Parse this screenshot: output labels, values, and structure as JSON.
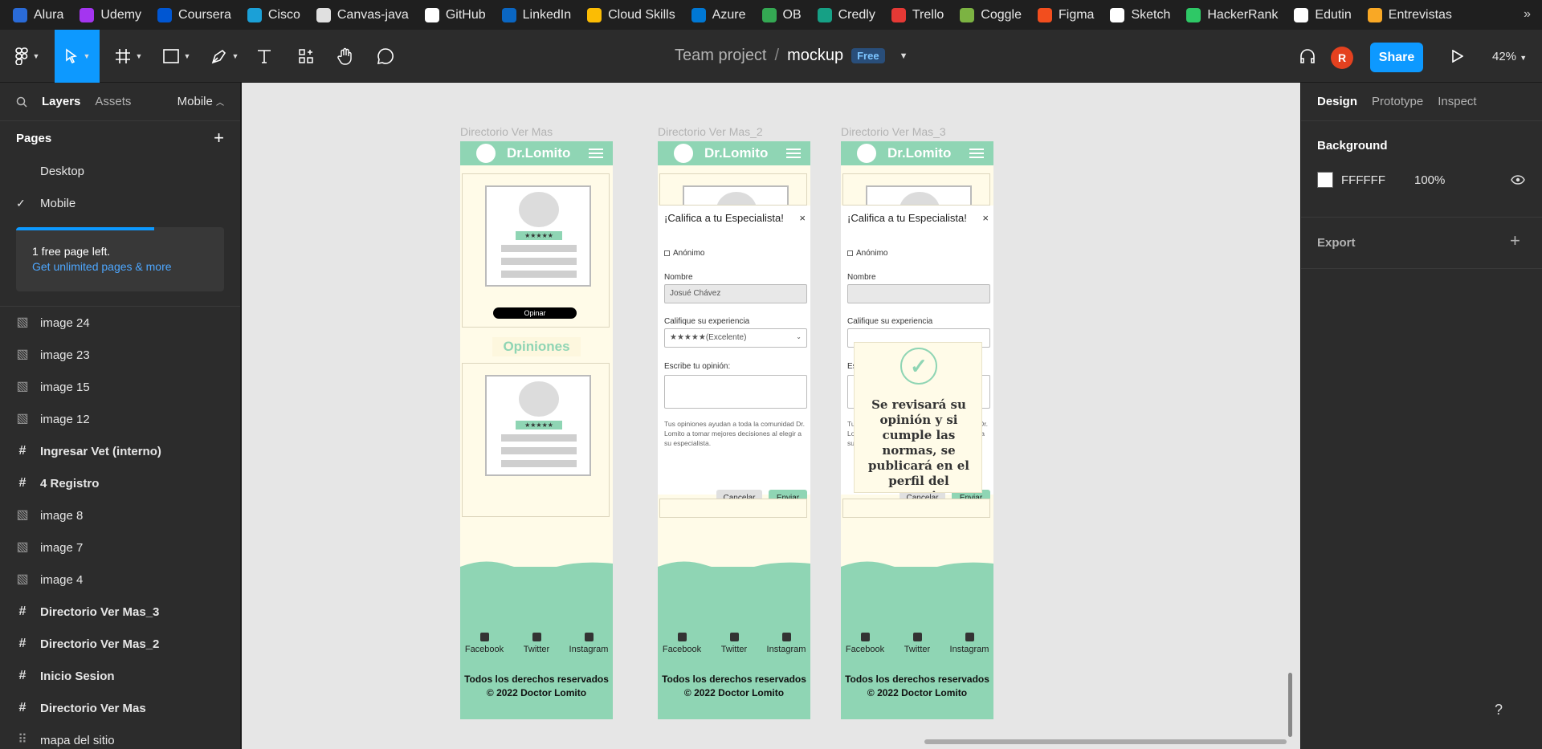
{
  "bookmarks": [
    {
      "label": "Alura",
      "color": "#2a6bd8"
    },
    {
      "label": "Udemy",
      "color": "#a435f0"
    },
    {
      "label": "Coursera",
      "color": "#0056d2"
    },
    {
      "label": "Cisco",
      "color": "#1ba0d7"
    },
    {
      "label": "Canvas-java",
      "color": "#e0e0e0"
    },
    {
      "label": "GitHub",
      "color": "#ffffff"
    },
    {
      "label": "LinkedIn",
      "color": "#0a66c2"
    },
    {
      "label": "Cloud Skills",
      "color": "#fbbc04"
    },
    {
      "label": "Azure",
      "color": "#0078d4"
    },
    {
      "label": "OB",
      "color": "#34a853"
    },
    {
      "label": "Credly",
      "color": "#16a085"
    },
    {
      "label": "Trello",
      "color": "#e53935"
    },
    {
      "label": "Coggle",
      "color": "#7cb342"
    },
    {
      "label": "Figma",
      "color": "#f24e1e"
    },
    {
      "label": "Sketch",
      "color": "#ffffff"
    },
    {
      "label": "HackerRank",
      "color": "#2ec866"
    },
    {
      "label": "Edutin",
      "color": "#ffffff"
    },
    {
      "label": "Entrevistas",
      "color": "#f9a825"
    }
  ],
  "bookmarks_more": "»",
  "header": {
    "team": "Team project",
    "sep": "/",
    "file": "mockup",
    "badge": "Free",
    "share": "Share",
    "avatar": "R",
    "zoom": "42%"
  },
  "left": {
    "tabs": {
      "layers": "Layers",
      "assets": "Assets",
      "page": "Mobile"
    },
    "pages_title": "Pages",
    "pages": [
      {
        "label": "Desktop",
        "checked": false
      },
      {
        "label": "Mobile",
        "checked": true
      }
    ],
    "promo": {
      "line1": "1 free page left.",
      "link": "Get unlimited pages & more"
    },
    "layers": [
      {
        "label": "image 24",
        "type": "image"
      },
      {
        "label": "image 23",
        "type": "image"
      },
      {
        "label": "image 15",
        "type": "image"
      },
      {
        "label": "image 12",
        "type": "image"
      },
      {
        "label": "Ingresar Vet (interno)",
        "type": "frame"
      },
      {
        "label": "4 Registro",
        "type": "frame"
      },
      {
        "label": "image 8",
        "type": "image"
      },
      {
        "label": "image 7",
        "type": "image"
      },
      {
        "label": "image 4",
        "type": "image"
      },
      {
        "label": "Directorio Ver Mas_3",
        "type": "frame"
      },
      {
        "label": "Directorio Ver Mas_2",
        "type": "frame"
      },
      {
        "label": "Inicio Sesion",
        "type": "frame"
      },
      {
        "label": "Directorio Ver Mas",
        "type": "frame"
      },
      {
        "label": "mapa del sitio",
        "type": "section"
      }
    ]
  },
  "right": {
    "tabs": {
      "design": "Design",
      "prototype": "Prototype",
      "inspect": "Inspect"
    },
    "background_title": "Background",
    "bg_hex": "FFFFFF",
    "bg_opacity": "100%",
    "export_title": "Export"
  },
  "canvas": {
    "frames": [
      {
        "label": "Directorio Ver Mas"
      },
      {
        "label": "Directorio Ver Mas_2"
      },
      {
        "label": "Directorio Ver Mas_3"
      }
    ],
    "brand": "Dr.Lomito",
    "stars": "★★★★★",
    "opinar": "Opinar",
    "opiniones": "Opiniones",
    "modal": {
      "title": "¡Califica a tu Especialista!",
      "close": "×",
      "anon": "Anónimo",
      "name_label": "Nombre",
      "name_value": "Josué Chávez",
      "exp_label": "Califique su experiencia",
      "exp_value": "★★★★★(Excelente)",
      "op_label": "Escribe tu opinión:",
      "note": "Tus opiniones ayudan a toda la comunidad Dr. Lomito a tomar mejores decisiones al elegir a su especialista.",
      "cancel": "Cancelar",
      "send": "Enviar"
    },
    "popup": "Se revisará su opinión y si cumple las normas, se publicará en el perfil del usuario",
    "footer": {
      "facebook": "Facebook",
      "twitter": "Twitter",
      "instagram": "Instagram",
      "copy": "Todos los derechos reservados © 2022 Doctor Lomito"
    }
  },
  "help": "?"
}
